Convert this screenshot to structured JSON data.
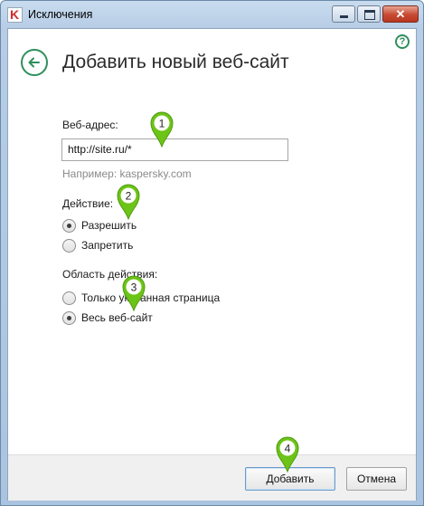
{
  "window": {
    "title": "Исключения",
    "app_icon": "kaspersky-k-icon",
    "minimize_icon": "minimize-icon",
    "maximize_icon": "maximize-icon",
    "close_icon": "close-icon",
    "close_glyph": "✕"
  },
  "header": {
    "title": "Добавить новый веб-сайт",
    "help_glyph": "?",
    "back_icon": "back-arrow-icon"
  },
  "form": {
    "url_label": "Веб-адрес:",
    "url_value": "http://site.ru/*",
    "url_hint": "Например: kaspersky.com",
    "action_label": "Действие:",
    "action_options": [
      {
        "label": "Разрешить",
        "checked": true
      },
      {
        "label": "Запретить",
        "checked": false
      }
    ],
    "scope_label": "Область действия:",
    "scope_options": [
      {
        "label": "Только указанная страница",
        "checked": false
      },
      {
        "label": "Весь веб-сайт",
        "checked": true
      }
    ]
  },
  "footer": {
    "add_label": "Добавить",
    "cancel_label": "Отмена"
  },
  "callouts": [
    {
      "number": "1"
    },
    {
      "number": "2"
    },
    {
      "number": "3"
    },
    {
      "number": "4"
    }
  ],
  "colors": {
    "accent_green": "#2f8f5c",
    "callout_green": "#6cc417"
  }
}
